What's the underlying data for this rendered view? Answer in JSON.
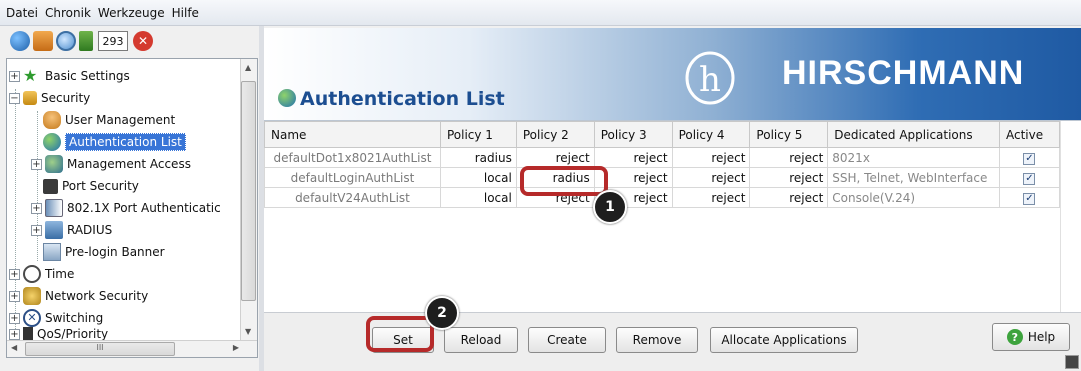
{
  "menubar": {
    "items": [
      "Datei",
      "Chronik",
      "Werkzeuge",
      "Hilfe"
    ]
  },
  "toolbar": {
    "counter": "293",
    "icons": [
      "network-icon",
      "user-lock-icon",
      "search-icon",
      "signal-icon",
      "close-icon"
    ]
  },
  "tree": {
    "items": [
      {
        "label": "Basic Settings",
        "icon": "star-icon"
      },
      {
        "label": "Security",
        "icon": "lock-icon"
      },
      {
        "label": "User Management",
        "icon": "users-icon"
      },
      {
        "label": "Authentication List",
        "icon": "globe-icon",
        "selected": true
      },
      {
        "label": "Management Access",
        "icon": "network-icon"
      },
      {
        "label": "Port Security",
        "icon": "port-icon"
      },
      {
        "label": "802.1X Port Authenticatic",
        "icon": "port-auth-icon"
      },
      {
        "label": "RADIUS",
        "icon": "radius-icon"
      },
      {
        "label": "Pre-login Banner",
        "icon": "banner-icon"
      },
      {
        "label": "Time",
        "icon": "clock-icon"
      },
      {
        "label": "Network Security",
        "icon": "shield-icon"
      },
      {
        "label": "Switching",
        "icon": "switch-icon"
      },
      {
        "label": "QoS/Priority",
        "icon": "qos-icon"
      }
    ],
    "hscroll_label": "III"
  },
  "banner": {
    "title": "Authentication List",
    "brand": "HIRSCHMANN",
    "logo_letter": "h"
  },
  "table": {
    "headers": [
      "Name",
      "Policy 1",
      "Policy 2",
      "Policy 3",
      "Policy 4",
      "Policy 5",
      "Dedicated Applications",
      "Active"
    ],
    "rows": [
      {
        "name": "defaultDot1x8021AuthList",
        "p1": "radius",
        "p2": "reject",
        "p3": "reject",
        "p4": "reject",
        "p5": "reject",
        "apps": "8021x",
        "active": "✓"
      },
      {
        "name": "defaultLoginAuthList",
        "p1": "local",
        "p2": "radius",
        "p3": "reject",
        "p4": "reject",
        "p5": "reject",
        "apps": "SSH, Telnet, WebInterface",
        "active": "✓"
      },
      {
        "name": "defaultV24AuthList",
        "p1": "local",
        "p2": "reject",
        "p3": "reject",
        "p4": "reject",
        "p5": "reject",
        "apps": "Console(V.24)",
        "active": "✓"
      }
    ]
  },
  "callouts": [
    "1",
    "2"
  ],
  "buttons": {
    "set": "Set",
    "reload": "Reload",
    "create": "Create",
    "remove": "Remove",
    "allocate": "Allocate Applications",
    "help": "Help",
    "help_icon": "?"
  },
  "colors": {
    "highlight": "#b62a2a",
    "selection": "#3875d7",
    "brand_blue": "#1f5aa3"
  }
}
